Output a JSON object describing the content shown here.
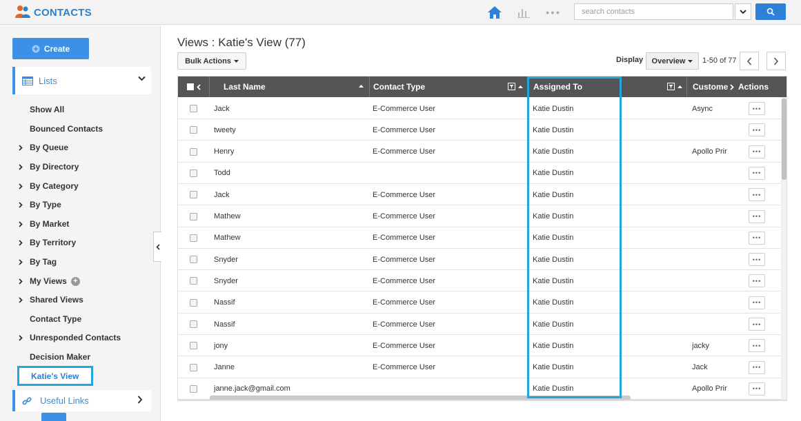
{
  "app": {
    "title": "CONTACTS"
  },
  "search": {
    "placeholder": "search contacts"
  },
  "sidebar": {
    "create_label": "Create",
    "lists_label": "Lists",
    "items": [
      {
        "label": "Show All",
        "expandable": false
      },
      {
        "label": "Bounced Contacts",
        "expandable": false
      },
      {
        "label": "By Queue",
        "expandable": true
      },
      {
        "label": "By Directory",
        "expandable": true
      },
      {
        "label": "By Category",
        "expandable": true
      },
      {
        "label": "By Type",
        "expandable": true
      },
      {
        "label": "By Market",
        "expandable": true
      },
      {
        "label": "By Territory",
        "expandable": true
      },
      {
        "label": "By Tag",
        "expandable": true
      },
      {
        "label": "My Views",
        "expandable": true,
        "plus": "+"
      },
      {
        "label": "Shared Views",
        "expandable": true
      },
      {
        "label": "Contact Type",
        "expandable": false
      },
      {
        "label": "Unresponded Contacts",
        "expandable": true
      },
      {
        "label": "Decision Maker",
        "expandable": false
      }
    ],
    "active_item": "Katie's View",
    "useful_links_label": "Useful Links"
  },
  "main": {
    "title": "Views : Katie's View (77)",
    "bulk_actions_label": "Bulk Actions",
    "display_label": "Display",
    "display_value": "Overview",
    "range": "1-50 of 77"
  },
  "table": {
    "columns": {
      "last_name": "Last Name",
      "contact_type": "Contact Type",
      "assigned_to": "Assigned To",
      "customer": "Custome",
      "actions": "Actions"
    },
    "rows": [
      {
        "last_name": "Jack",
        "contact_type": "E-Commerce User",
        "assigned_to": "Katie Dustin",
        "customer": "Async"
      },
      {
        "last_name": "tweety",
        "contact_type": "E-Commerce User",
        "assigned_to": "Katie Dustin",
        "customer": ""
      },
      {
        "last_name": "Henry",
        "contact_type": "E-Commerce User",
        "assigned_to": "Katie Dustin",
        "customer": "Apollo Prir"
      },
      {
        "last_name": "Todd",
        "contact_type": "",
        "assigned_to": "Katie Dustin",
        "customer": ""
      },
      {
        "last_name": "Jack",
        "contact_type": "E-Commerce User",
        "assigned_to": "Katie Dustin",
        "customer": ""
      },
      {
        "last_name": "Mathew",
        "contact_type": "E-Commerce User",
        "assigned_to": "Katie Dustin",
        "customer": ""
      },
      {
        "last_name": "Mathew",
        "contact_type": "E-Commerce User",
        "assigned_to": "Katie Dustin",
        "customer": ""
      },
      {
        "last_name": "Snyder",
        "contact_type": "E-Commerce User",
        "assigned_to": "Katie Dustin",
        "customer": ""
      },
      {
        "last_name": "Snyder",
        "contact_type": "E-Commerce User",
        "assigned_to": "Katie Dustin",
        "customer": ""
      },
      {
        "last_name": "Nassif",
        "contact_type": "E-Commerce User",
        "assigned_to": "Katie Dustin",
        "customer": ""
      },
      {
        "last_name": "Nassif",
        "contact_type": "E-Commerce User",
        "assigned_to": "Katie Dustin",
        "customer": ""
      },
      {
        "last_name": "jony",
        "contact_type": "E-Commerce User",
        "assigned_to": "Katie Dustin",
        "customer": "jacky"
      },
      {
        "last_name": "Janne",
        "contact_type": "E-Commerce User",
        "assigned_to": "Katie Dustin",
        "customer": "Jack"
      },
      {
        "last_name": "janne.jack@gmail.com",
        "contact_type": "",
        "assigned_to": "Katie Dustin",
        "customer": "Apollo Prir"
      }
    ]
  },
  "colors": {
    "accent": "#3c90e6",
    "highlight": "#23a5de",
    "header_bg": "#555555"
  }
}
